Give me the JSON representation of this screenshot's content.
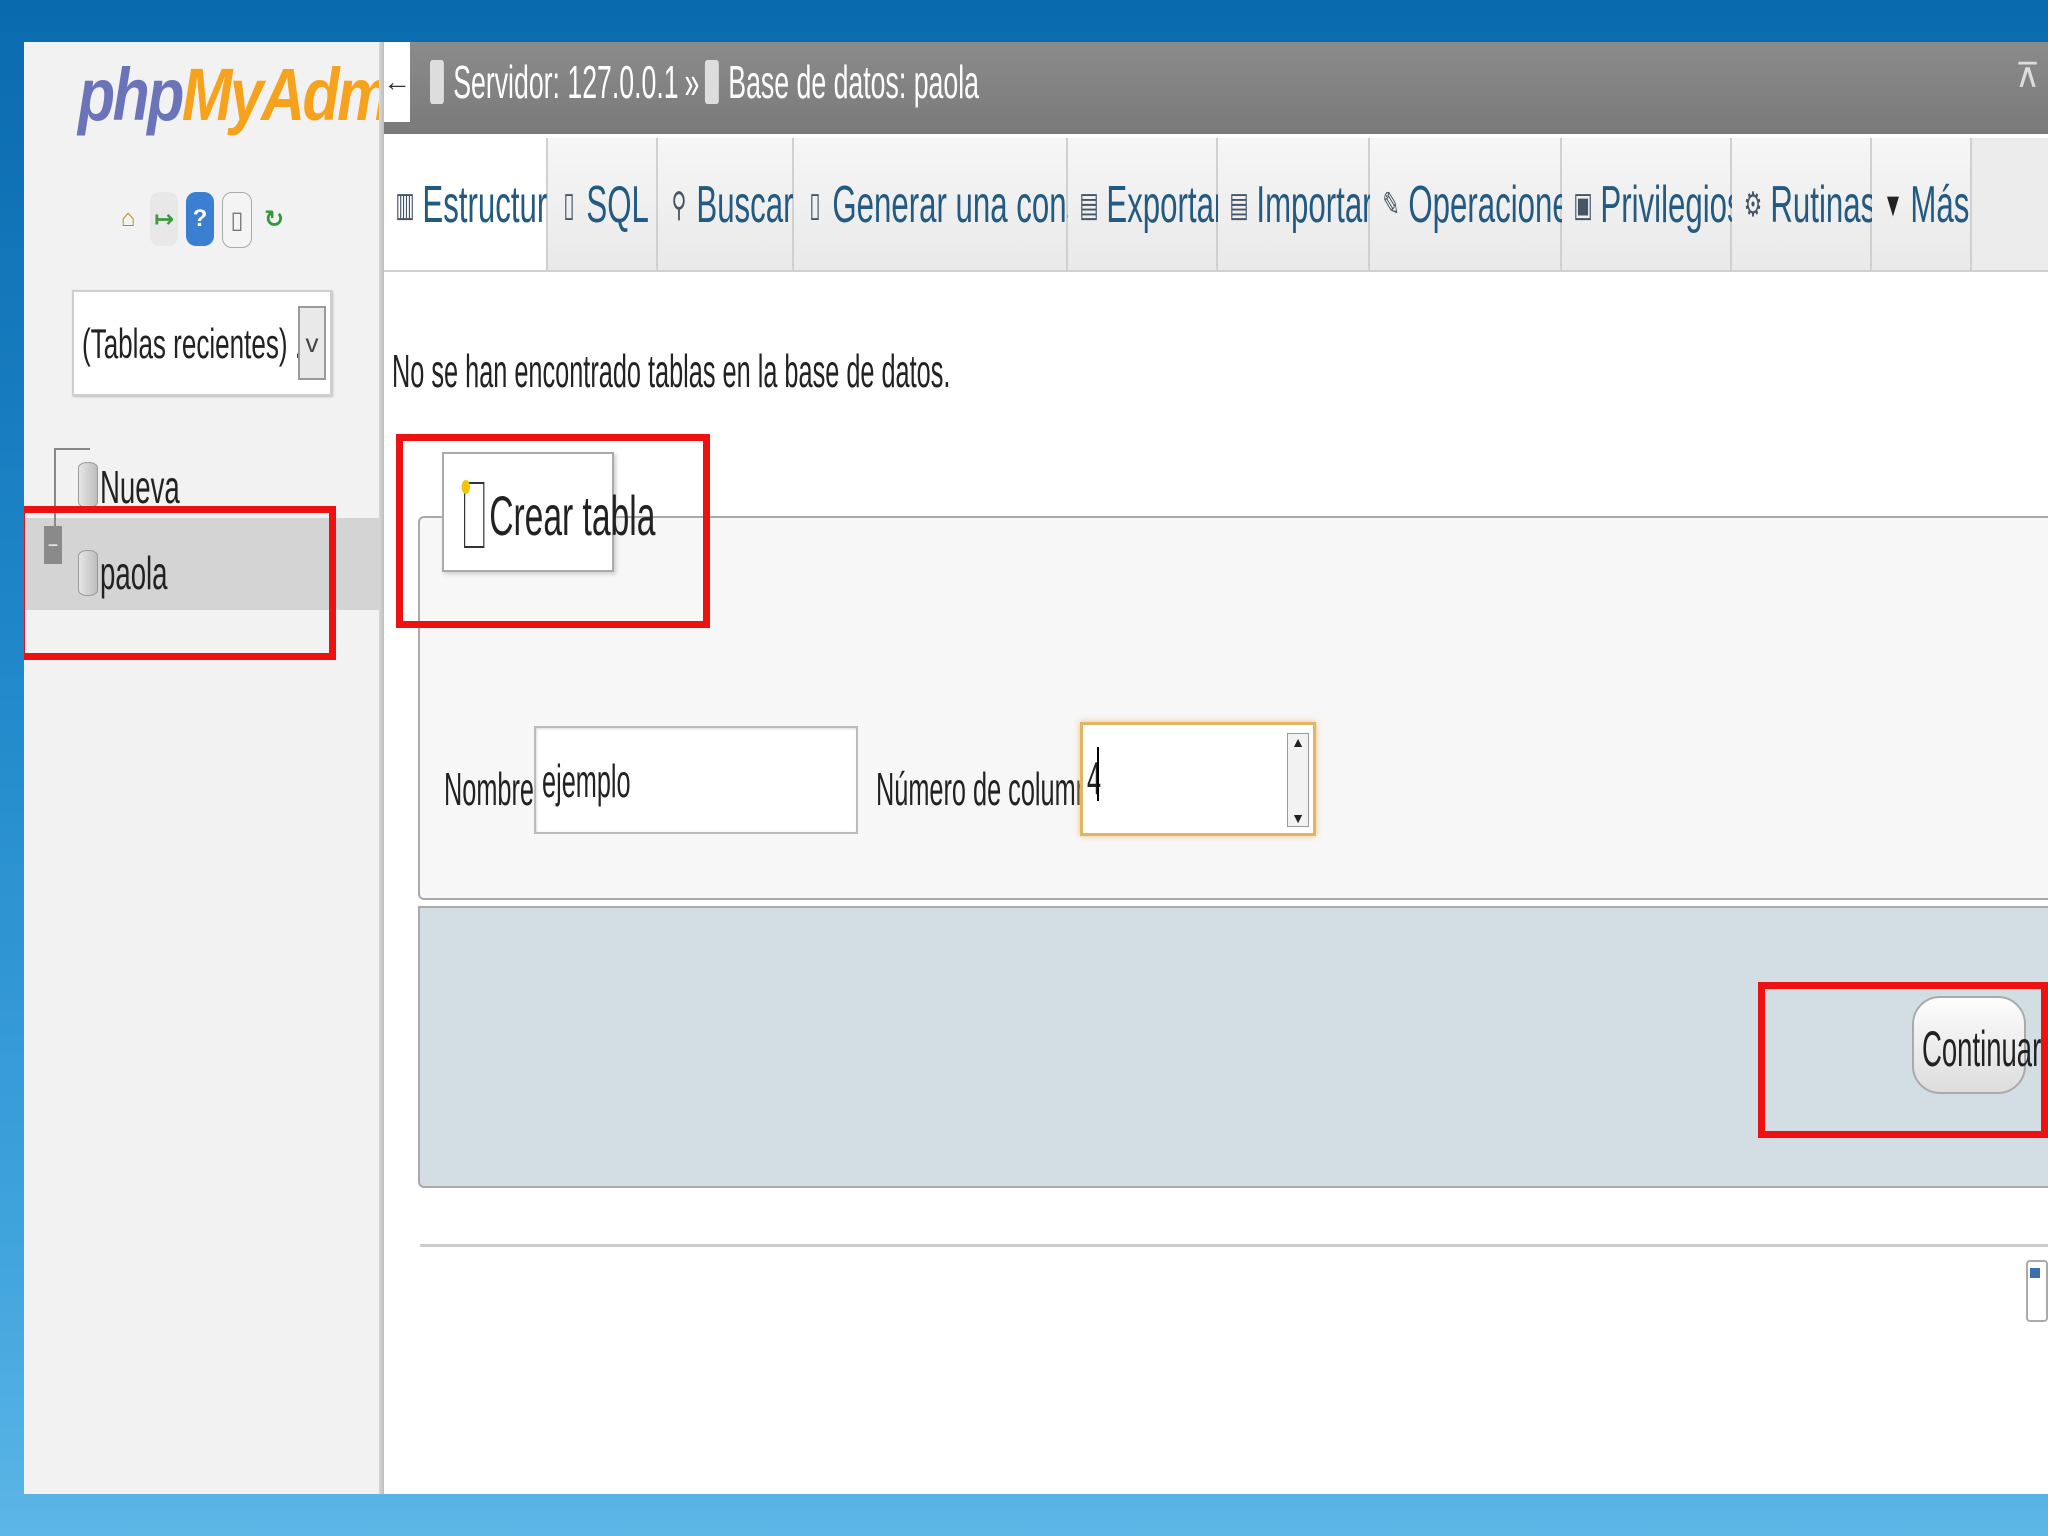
{
  "app": {
    "logo_php": "php",
    "logo_myadmin": "MyAdmin"
  },
  "sidebar": {
    "quick_icons": [
      "home-icon",
      "logout-icon",
      "help-icon",
      "docs-icon",
      "reload-icon"
    ],
    "recent_tables": "(Tablas recientes) ...",
    "tree": [
      {
        "label": "Nueva"
      },
      {
        "label": "paola",
        "selected": true
      }
    ]
  },
  "header": {
    "server_label": "Servidor: 127.0.0.1",
    "separator": "»",
    "database_label": "Base de datos: paola"
  },
  "tabs": [
    {
      "label": "Estructura",
      "icon": "structure-icon",
      "active": true
    },
    {
      "label": "SQL",
      "icon": "sql-icon"
    },
    {
      "label": "Buscar",
      "icon": "search-icon"
    },
    {
      "label": "Generar una consulta",
      "icon": "query-icon"
    },
    {
      "label": "Exportar",
      "icon": "export-icon"
    },
    {
      "label": "Importar",
      "icon": "import-icon"
    },
    {
      "label": "Operaciones",
      "icon": "wrench-icon"
    },
    {
      "label": "Privilegios",
      "icon": "privileges-icon"
    },
    {
      "label": "Rutinas",
      "icon": "routines-icon"
    },
    {
      "label": "Más",
      "icon": "triangle-down-icon"
    }
  ],
  "main": {
    "notice": "No se han encontrado tablas en la base de datos.",
    "create_table": {
      "legend": "Crear tabla",
      "name_label": "Nombre:",
      "name_value": "ejemplo",
      "columns_label": "Número de columnas:",
      "columns_value": "4",
      "submit_label": "Continuar"
    }
  },
  "colors": {
    "highlight": "#ee1111",
    "tab_text": "#235a81",
    "logo_php": "#6c74b9",
    "logo_myadmin": "#f7a21c"
  }
}
